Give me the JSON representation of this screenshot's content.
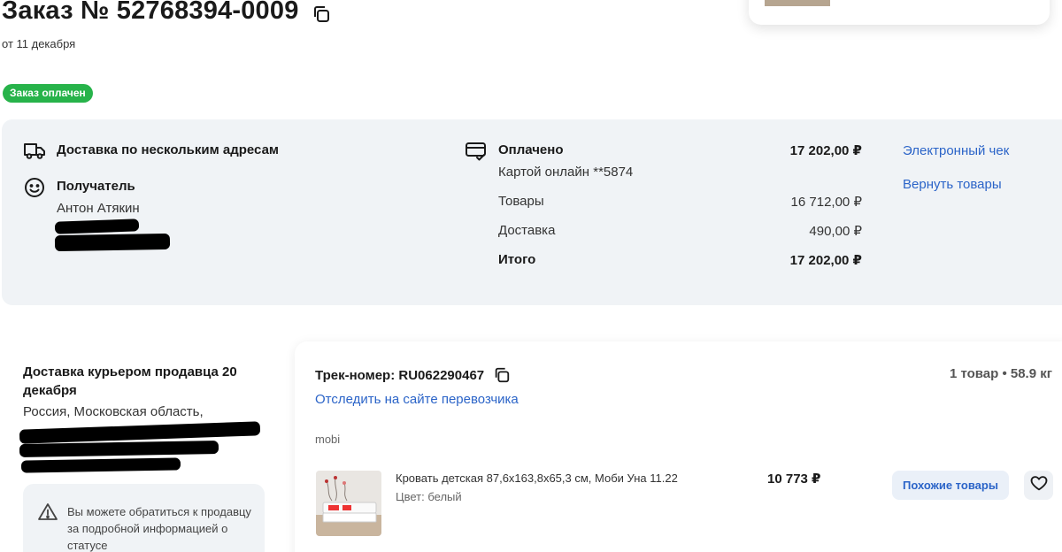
{
  "order": {
    "title": "Заказ № 52768394-0009",
    "date": "от 11 декабря",
    "status": "Заказ оплачен",
    "status_color": "#27b34a"
  },
  "summary": {
    "delivery_label": "Доставка по нескольким адресам",
    "recipient_label": "Получатель",
    "recipient_name": "Антон Атякин",
    "payment_label": "Оплачено",
    "payment_total": "17 202,00 ₽",
    "payment_method": "Картой онлайн **5874",
    "goods_label": "Товары",
    "goods_amount": "16 712,00 ₽",
    "shipping_label": "Доставка",
    "shipping_amount": "490,00 ₽",
    "total_label": "Итого",
    "total_amount": "17 202,00 ₽",
    "receipt_link": "Электронный чек",
    "return_link": "Вернуть товары"
  },
  "shipment": {
    "title": "Доставка курьером продавца 20 декабря",
    "address": "Россия, Московская область,",
    "info": "Вы можете обратиться к продавцу за подробной информацией о статусе",
    "track_label": "Трек-номер: RU062290467",
    "track_link": "Отследить на сайте перевозчика",
    "count_weight": "1 товар • 58.9 кг",
    "seller": "mobi"
  },
  "product": {
    "name": "Кровать детская 87,6х163,8х65,3 см, Моби Уна 11.22",
    "color": "Цвет: белый",
    "price": "10 773 ₽",
    "similar_button": "Похожие товары"
  },
  "colors": {
    "link": "#2b64c8",
    "panel": "#f0f3f6",
    "badge": "#27b34a"
  }
}
